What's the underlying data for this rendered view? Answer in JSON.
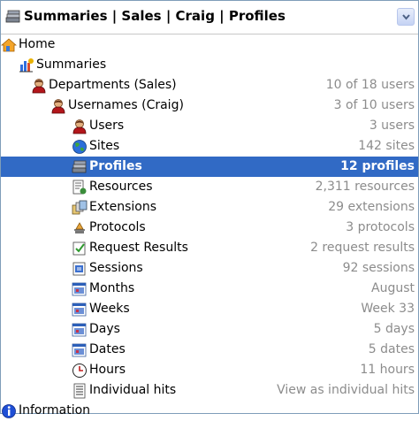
{
  "header": {
    "title": "Summaries | Sales | Craig | Profiles"
  },
  "tree": [
    {
      "label": "Home",
      "value": "",
      "icon": "home-icon"
    },
    {
      "label": "Summaries",
      "value": "",
      "icon": "summaries-chart-icon"
    },
    {
      "label": "Departments (Sales)",
      "value": "10 of 18 users",
      "icon": "user-icon"
    },
    {
      "label": "Usernames (Craig)",
      "value": "3 of 10 users",
      "icon": "user-icon"
    },
    {
      "label": "Users",
      "value": "3 users",
      "icon": "user-icon"
    },
    {
      "label": "Sites",
      "value": "142 sites",
      "icon": "globe-icon"
    },
    {
      "label": "Profiles",
      "value": "12 profiles",
      "icon": "profiles-icon",
      "selected": true
    },
    {
      "label": "Resources",
      "value": "2,311 resources",
      "icon": "resources-icon"
    },
    {
      "label": "Extensions",
      "value": "29 extensions",
      "icon": "extensions-icon"
    },
    {
      "label": "Protocols",
      "value": "3 protocols",
      "icon": "protocols-icon"
    },
    {
      "label": "Request Results",
      "value": "2 request results",
      "icon": "request-results-icon"
    },
    {
      "label": "Sessions",
      "value": "92 sessions",
      "icon": "sessions-icon"
    },
    {
      "label": "Months",
      "value": "August",
      "icon": "calendar-icon"
    },
    {
      "label": "Weeks",
      "value": "Week 33",
      "icon": "calendar-icon"
    },
    {
      "label": "Days",
      "value": "5 days",
      "icon": "calendar-icon"
    },
    {
      "label": "Dates",
      "value": "5 dates",
      "icon": "calendar-icon"
    },
    {
      "label": "Hours",
      "value": "11 hours",
      "icon": "clock-icon"
    },
    {
      "label": "Individual hits",
      "value": "View as individual hits",
      "icon": "document-list-icon"
    },
    {
      "label": "Information",
      "value": "",
      "icon": "info-icon"
    }
  ],
  "colors": {
    "selection": "#316ac5",
    "value_text": "#8c8c8c"
  }
}
